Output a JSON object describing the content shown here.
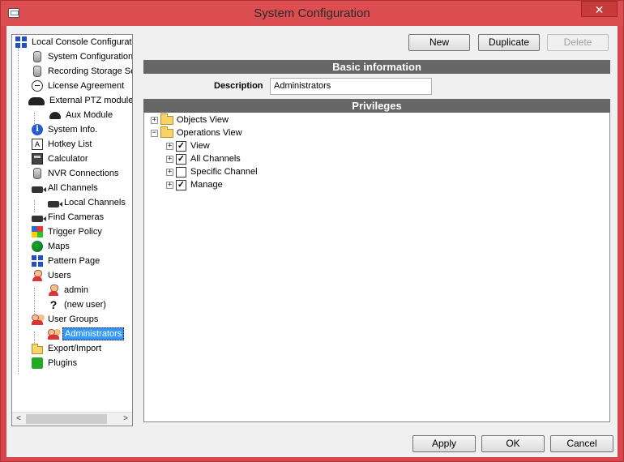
{
  "window": {
    "title": "System Configuration",
    "close_glyph": "✕"
  },
  "tree": {
    "items": [
      {
        "label": "Local Console Configurati",
        "icon": "grid-icon"
      },
      {
        "label": "System Configuration",
        "icon": "database-icon"
      },
      {
        "label": "Recording Storage Se",
        "icon": "database-icon"
      },
      {
        "label": "License Agreement",
        "icon": "speech-bubble-icon"
      },
      {
        "label": "External PTZ module",
        "icon": "ptz-camera-icon"
      },
      {
        "label": "Aux Module",
        "icon": "ptz-camera-icon"
      },
      {
        "label": "System Info.",
        "icon": "info-icon"
      },
      {
        "label": "Hotkey List",
        "icon": "hotkey-icon"
      },
      {
        "label": "Calculator",
        "icon": "calculator-icon"
      },
      {
        "label": "NVR Connections",
        "icon": "database-icon"
      },
      {
        "label": "All Channels",
        "icon": "camera-icon"
      },
      {
        "label": "Local Channels",
        "icon": "camera-icon"
      },
      {
        "label": "Find Cameras",
        "icon": "camera-icon"
      },
      {
        "label": "Trigger Policy",
        "icon": "trigger-icon"
      },
      {
        "label": "Maps",
        "icon": "globe-icon"
      },
      {
        "label": "Pattern Page",
        "icon": "pattern-icon"
      },
      {
        "label": "Users",
        "icon": "user-icon"
      },
      {
        "label": "admin",
        "icon": "user-icon"
      },
      {
        "label": "(new user)",
        "icon": "question-icon"
      },
      {
        "label": "User Groups",
        "icon": "user-group-icon"
      },
      {
        "label": "Administrators",
        "icon": "user-group-icon"
      },
      {
        "label": "Export/Import",
        "icon": "folder-icon"
      },
      {
        "label": "Plugins",
        "icon": "puzzle-icon"
      }
    ],
    "selected": "Administrators",
    "scroll_left": "<",
    "scroll_right": ">"
  },
  "toolbar": {
    "new_label": "New",
    "duplicate_label": "Duplicate",
    "delete_label": "Delete"
  },
  "basic_info": {
    "header": "Basic information",
    "description_label": "Description",
    "description_value": "Administrators"
  },
  "privileges": {
    "header": "Privileges",
    "items": [
      {
        "label": "Objects View",
        "checked": null
      },
      {
        "label": "Operations View",
        "checked": null
      },
      {
        "label": "View",
        "checked": true
      },
      {
        "label": "All Channels",
        "checked": true
      },
      {
        "label": "Specific Channel",
        "checked": false
      },
      {
        "label": "Manage",
        "checked": true
      }
    ]
  },
  "footer": {
    "apply_label": "Apply",
    "ok_label": "OK",
    "cancel_label": "Cancel"
  }
}
